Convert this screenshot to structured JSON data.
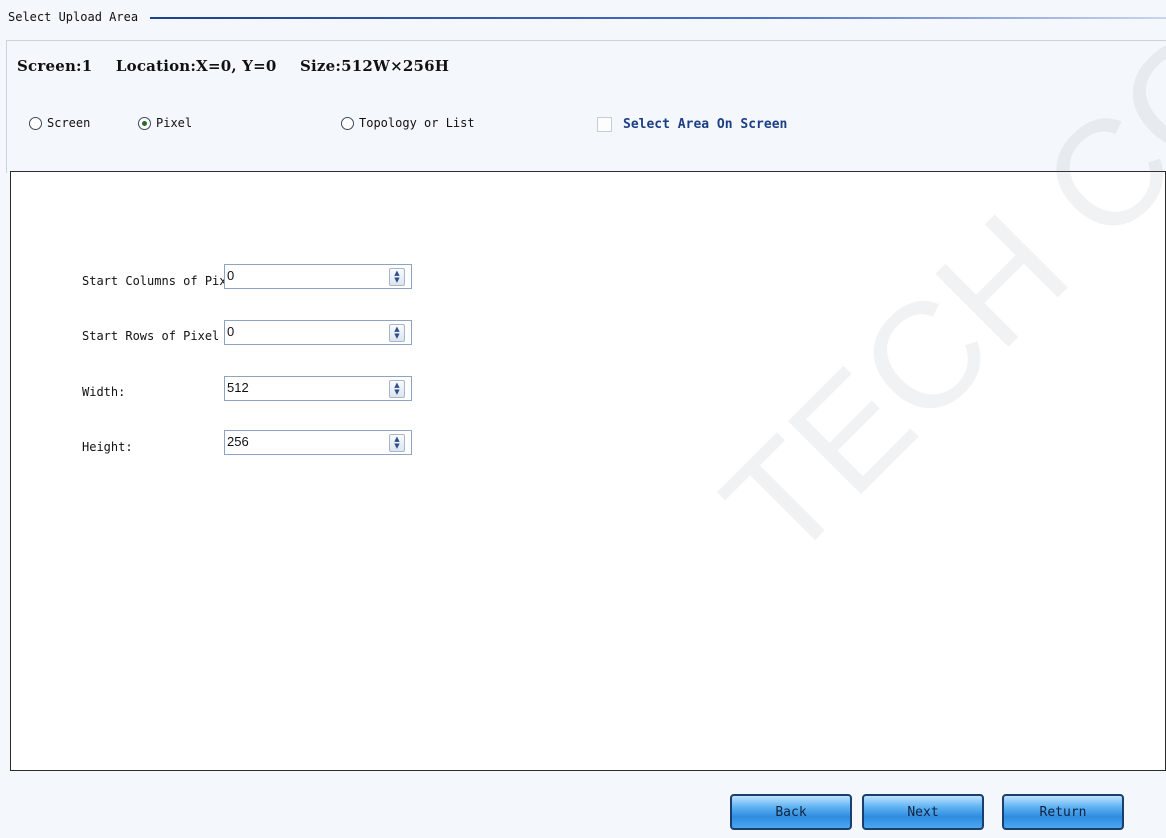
{
  "group": {
    "title": "Select Upload Area"
  },
  "info": {
    "screen": "Screen:1",
    "location": "Location:X=0, Y=0",
    "size": "Size:512W×256H"
  },
  "options": {
    "screen_label": "Screen",
    "pixel_label": "Pixel",
    "topology_label": "Topology or List",
    "selected": "Pixel",
    "select_area_label": "Select Area On Screen",
    "select_area_checked": false
  },
  "fields": {
    "start_columns": {
      "label": "Start Columns of Pixel",
      "value": "0"
    },
    "start_rows": {
      "label": "Start Rows of Pixel",
      "value": "0"
    },
    "width": {
      "label": "Width:",
      "value": "512"
    },
    "height": {
      "label": "Height:",
      "value": "256"
    }
  },
  "buttons": {
    "back": "Back",
    "next": "Next",
    "return": "Return"
  },
  "watermark": "TECH CO., L"
}
